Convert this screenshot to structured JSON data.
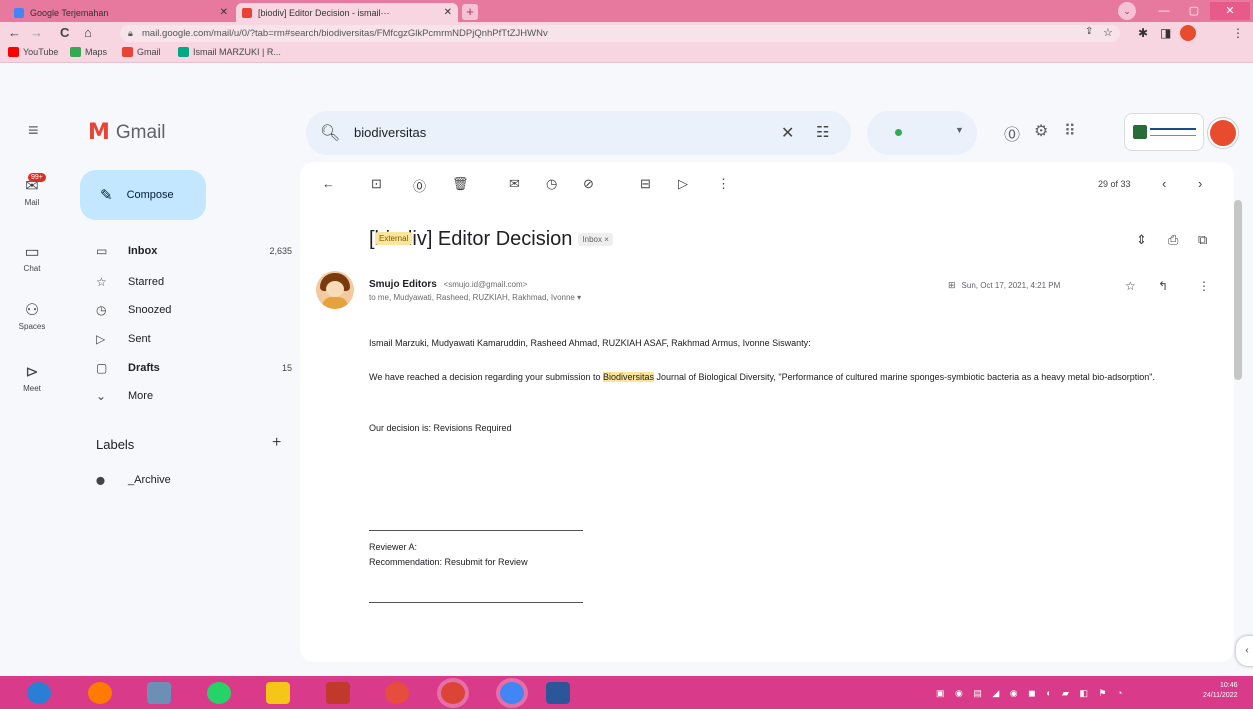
{
  "browser": {
    "tabs": [
      {
        "title": "Google Terjemahan",
        "favicon_color": "#4285f4",
        "close": "✕"
      },
      {
        "title": "[biodiv] Editor Decision - ismail···",
        "favicon_color": "#ea4335",
        "close": "✕"
      }
    ],
    "new_tab": "+",
    "url": "mail.google.com/mail/u/0/?tab=rm#search/biodiversitas/FMfcgzGlkPcmrmNDPjQnhPfTtZJHWNv",
    "bookmarks": [
      {
        "label": "YouTube",
        "color": "#ff0000"
      },
      {
        "label": "Maps",
        "color": "#34a853"
      },
      {
        "label": "Gmail",
        "color": "#ea4335"
      },
      {
        "label": "Ismail MARZUKI | R...",
        "color": "#00a884"
      }
    ],
    "nav_icons": {
      "back": "←",
      "forward": "→",
      "reload": "C",
      "home": "⌂"
    }
  },
  "gmail": {
    "logo_text": "Gmail",
    "search": {
      "value": "biodiversitas"
    },
    "rail": [
      {
        "label": "Mail",
        "icon": "✉",
        "badge": "99+"
      },
      {
        "label": "Chat",
        "icon": "▭"
      },
      {
        "label": "Spaces",
        "icon": "⚇"
      },
      {
        "label": "Meet",
        "icon": "⊳"
      }
    ],
    "compose_label": "Compose",
    "nav": [
      {
        "label": "Inbox",
        "count": "2,635",
        "icon": "▭",
        "bold": true
      },
      {
        "label": "Starred",
        "count": "",
        "icon": "☆",
        "bold": false
      },
      {
        "label": "Snoozed",
        "count": "",
        "icon": "◷",
        "bold": false
      },
      {
        "label": "Sent",
        "count": "",
        "icon": "▷",
        "bold": false
      },
      {
        "label": "Drafts",
        "count": "15",
        "icon": "▢",
        "bold": true
      },
      {
        "label": "More",
        "count": "",
        "icon": "⌄",
        "bold": false
      }
    ],
    "labels_heading": "Labels",
    "labels_add": "+",
    "labels": [
      {
        "label": "_Archive",
        "icon": "⬤"
      }
    ],
    "pager": "29 of 33",
    "message": {
      "subject": "[biodiv] Editor Decision",
      "chip_external": "External",
      "chip_inbox": "Inbox ×",
      "sender_name": "Smujo Editors",
      "sender_email": "<smujo.id@gmail.com>",
      "to_line": "to me, Mudyawati, Rasheed, RUZKIAH, Rakhmad, Ivonne ▾",
      "date": "Sun, Oct 17, 2021, 4:21 PM",
      "recipients": "Ismail Marzuki, Mudyawati Kamaruddin, Rasheed Ahmad, RUZKIAH ASAF, Rakhmad Armus, Ivonne Siswanty:",
      "para_pre": "We have reached a decision regarding your submission to ",
      "para_highlight": "Biodiversitas",
      "para_post": " Journal of Biological Diversity, \"Performance of cultured marine sponges-symbiotic bacteria as a heavy metal bio-adsorption\".",
      "decision": "Our decision is: Revisions Required",
      "reviewer": "Reviewer A:",
      "recommendation": "Recommendation: Resubmit for Review"
    }
  },
  "taskbar": {
    "clock_time": "10:46",
    "clock_date": "24/11/2022"
  }
}
